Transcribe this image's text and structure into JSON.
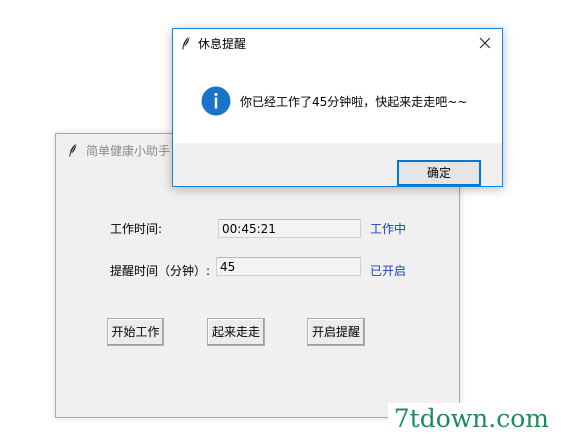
{
  "main_window": {
    "title": "简单健康小助手",
    "work_time": {
      "label": "工作时间:",
      "value": "00:45:21",
      "status": "工作中"
    },
    "remind_time": {
      "label": "提醒时间（分钟）:",
      "value": "45",
      "status": "已开启"
    },
    "buttons": {
      "start_work": "开始工作",
      "get_up": "起来走走",
      "enable_reminder": "开启提醒"
    }
  },
  "dialog": {
    "title": "休息提醒",
    "message": "你已经工作了45分钟啦，快起来走走吧~~",
    "ok_label": "确定",
    "icon": "info-icon"
  },
  "watermark": {
    "text": "7tdown.com"
  },
  "colors": {
    "status_text": "#1c3fb8",
    "info_icon": "#1a73c9",
    "dialog_border": "#1883d7",
    "watermark": "#1e8c5a"
  }
}
